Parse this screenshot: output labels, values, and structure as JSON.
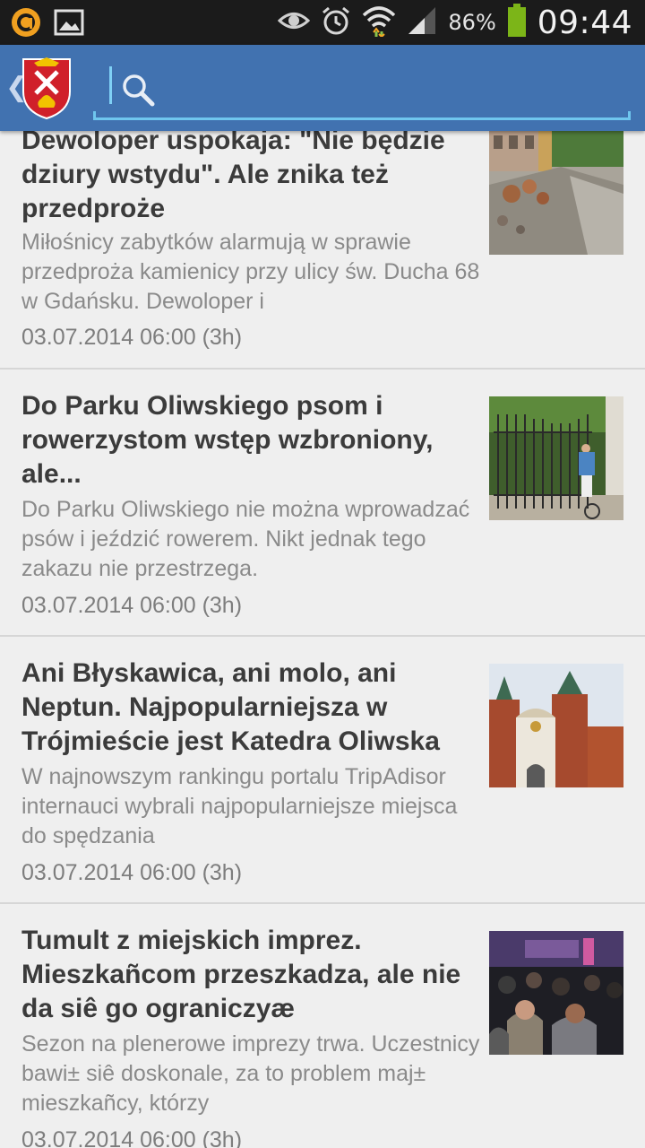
{
  "status_bar": {
    "battery_percent": "86%",
    "time": "09:44",
    "icons": [
      "app-notification-icon",
      "image-icon",
      "eye-icon",
      "alarm-icon",
      "wifi-icon",
      "signal-icon",
      "battery-icon"
    ],
    "battery_color": "#7cb518"
  },
  "action_bar": {
    "background": "#4172b0",
    "back_glyph": "❮",
    "search_placeholder": "",
    "search_value": ""
  },
  "articles": [
    {
      "title": "Dewoloper uspokaja: \"Nie będzie dziury wstydu\". Ale znika też przedproże",
      "summary": "Miłośnicy zabytków alarmują w sprawie przedproża kamienicy przy ulicy św. Ducha 68 w Gdańsku. Dewoloper i",
      "date": "03.07.2014 06:00 (3h)",
      "thumbnail": "street-construction-photo"
    },
    {
      "title": "Do Parku Oliwskiego psom i rowerzystom wstęp wzbroniony, ale...",
      "summary": "Do Parku Oliwskiego nie można wprowadzać psów i jeździć rowerem. Nikt jednak tego zakazu nie przestrzega.",
      "date": "03.07.2014 06:00 (3h)",
      "thumbnail": "park-gate-cyclist-photo"
    },
    {
      "title": "Ani Błyskawica, ani molo, ani Neptun. Najpopularniejsza w Trójmieście jest Katedra Oliwska",
      "summary": "W najnowszym rankingu portalu TripAdisor internauci wybrali najpopularniejsze miejsca do spędzania",
      "date": "03.07.2014 06:00 (3h)",
      "thumbnail": "oliwa-cathedral-photo"
    },
    {
      "title": "Tumult z miejskich imprez. Mieszkañcom przeszkadza, ale nie da siê go ograniczyæ",
      "summary": "Sezon na plenerowe imprezy trwa. Uczestnicy bawi± siê doskonale, za to problem maj± mieszkañcy, którzy",
      "date": "03.07.2014 06:00 (3h)",
      "thumbnail": "concert-crowd-photo"
    }
  ]
}
